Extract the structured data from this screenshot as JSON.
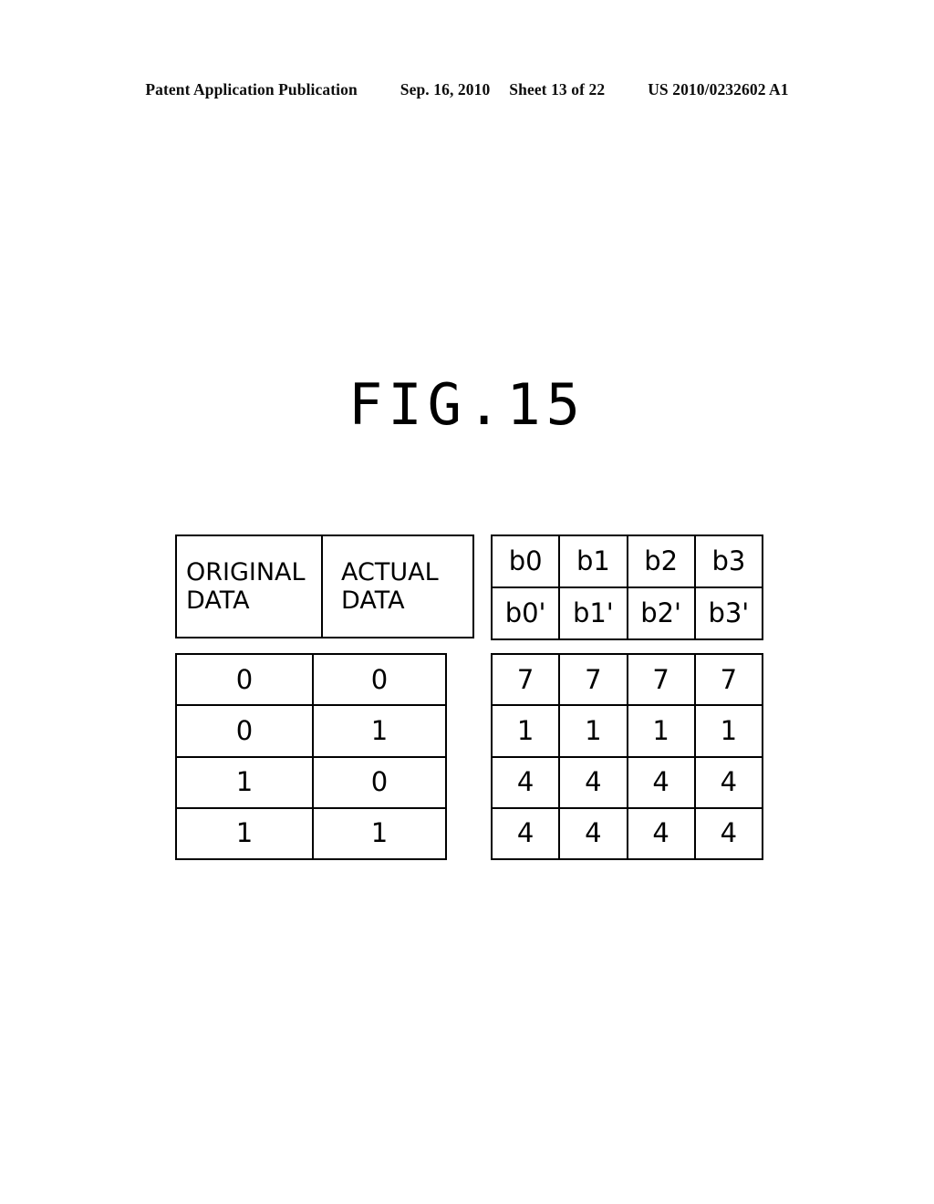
{
  "page_header": {
    "publication": "Patent Application Publication",
    "date": "Sep. 16, 2010",
    "sheet": "Sheet 13 of 22",
    "patent_number": "US 2010/0232602 A1"
  },
  "figure": {
    "title": "FIG.15",
    "left_table": {
      "headers": [
        {
          "line1": "ORIGINAL",
          "line2": "DATA"
        },
        {
          "line1": "ACTUAL",
          "line2": "DATA"
        }
      ],
      "rows": [
        [
          "0",
          "0"
        ],
        [
          "0",
          "1"
        ],
        [
          "1",
          "0"
        ],
        [
          "1",
          "1"
        ]
      ]
    },
    "right_table": {
      "header_row_1": [
        "b0",
        "b1",
        "b2",
        "b3"
      ],
      "header_row_2": [
        "b0'",
        "b1'",
        "b2'",
        "b3'"
      ],
      "rows": [
        [
          "7",
          "7",
          "7",
          "7"
        ],
        [
          "1",
          "1",
          "1",
          "1"
        ],
        [
          "4",
          "4",
          "4",
          "4"
        ],
        [
          "4",
          "4",
          "4",
          "4"
        ]
      ]
    }
  }
}
